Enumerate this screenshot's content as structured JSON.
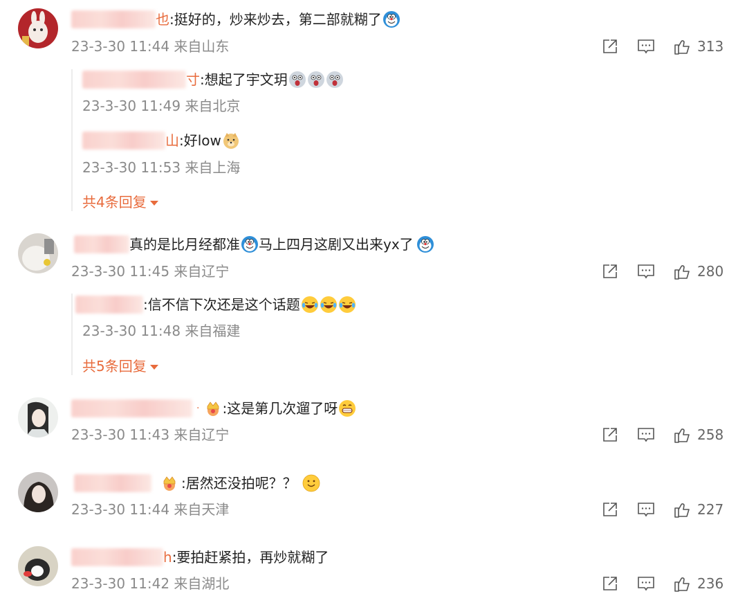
{
  "comments": [
    {
      "text_tail": "也",
      "text": ":挺好的，炒来炒去，第二部就糊了",
      "meta": "23-3-30 11:44 来自山东",
      "likes": "313",
      "replies": [
        {
          "text_tail": "寸",
          "text": ":想起了宇文玥",
          "meta": "23-3-30 11:49 来自北京"
        },
        {
          "text_tail": "山",
          "text": ":好low",
          "meta": "23-3-30 11:53 来自上海"
        }
      ],
      "more_label": "共4条回复"
    },
    {
      "text": "真的是比月经都准",
      "text2": "马上四月这剧又出来yx了",
      "meta": "23-3-30 11:45 来自辽宁",
      "likes": "280",
      "replies": [
        {
          "text": ":信不信下次还是这个话题",
          "meta": "23-3-30 11:48 来自福建"
        }
      ],
      "more_label": "共5条回复"
    },
    {
      "text": ":这是第几次遛了呀",
      "meta": "23-3-30 11:43 来自辽宁",
      "likes": "258"
    },
    {
      "text": ":居然还没拍呢？？",
      "meta": "23-3-30 11:44 来自天津",
      "likes": "227"
    },
    {
      "text_tail": "h",
      "text": ":要拍赶紧拍，再炒就糊了",
      "meta": "23-3-30 11:42 来自湖北",
      "likes": "236"
    }
  ],
  "colors": {
    "accent": "#e86b3c",
    "meta": "#8a8a8a",
    "blur": "#f9c9c4"
  }
}
